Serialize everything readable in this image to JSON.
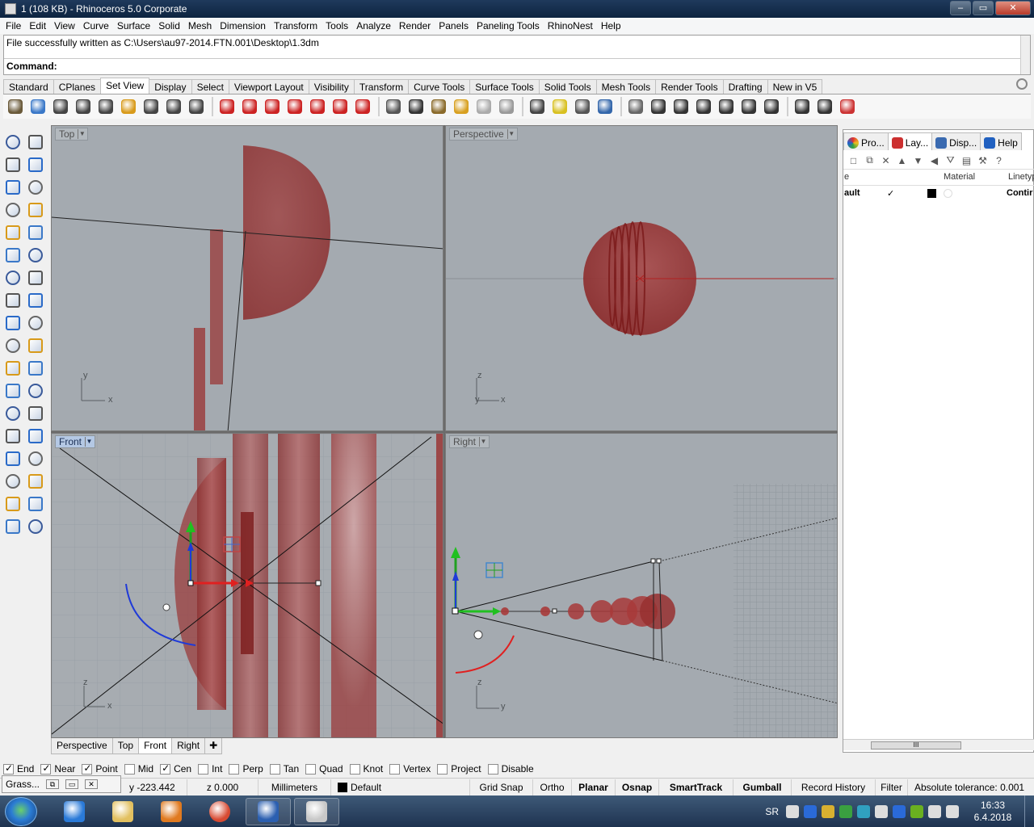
{
  "window": {
    "title": "1 (108 KB) - Rhinoceros  5.0 Corporate",
    "controls": [
      "–",
      "▭",
      "✕"
    ]
  },
  "menu": [
    "File",
    "Edit",
    "View",
    "Curve",
    "Surface",
    "Solid",
    "Mesh",
    "Dimension",
    "Transform",
    "Tools",
    "Analyze",
    "Render",
    "Panels",
    "Paneling Tools",
    "RhinoNest",
    "Help"
  ],
  "command": {
    "history": "File successfully written as C:\\Users\\au97-2014.FTN.001\\Desktop\\1.3dm",
    "prompt": "Command:"
  },
  "toolbar_tabs": [
    "Standard",
    "CPlanes",
    "Set View",
    "Display",
    "Select",
    "Viewport Layout",
    "Visibility",
    "Transform",
    "Curve Tools",
    "Surface Tools",
    "Solid Tools",
    "Mesh Tools",
    "Render Tools",
    "Drafting",
    "New in V5"
  ],
  "active_toolbar_tab": "Set View",
  "toolbar_icons": [
    {
      "name": "pan-icon",
      "color": "#6a5a3a"
    },
    {
      "name": "rotate-view-icon",
      "color": "#3a78c8"
    },
    {
      "name": "zoom-icon",
      "color": "#444444"
    },
    {
      "name": "zoom-extents-icon",
      "color": "#444444"
    },
    {
      "name": "zoom-window-icon",
      "color": "#444444"
    },
    {
      "name": "zoom-selected-icon",
      "color": "#d89a1a"
    },
    {
      "name": "undo-view-icon",
      "color": "#444444"
    },
    {
      "name": "zoom-out-icon",
      "color": "#444444"
    },
    {
      "name": "zoom-1to1-icon",
      "color": "#444444"
    },
    {
      "name": "viewport-top-icon",
      "color": "#cc2222"
    },
    {
      "name": "viewport-front-icon",
      "color": "#cc2222"
    },
    {
      "name": "car-view-1-icon",
      "color": "#cc2222"
    },
    {
      "name": "car-view-2-icon",
      "color": "#cc2222"
    },
    {
      "name": "car-view-3-icon",
      "color": "#cc2222"
    },
    {
      "name": "car-view-4-icon",
      "color": "#cc2222"
    },
    {
      "name": "car-view-5-icon",
      "color": "#cc2222"
    },
    {
      "name": "camera-target-icon",
      "color": "#555555"
    },
    {
      "name": "camera-icon",
      "color": "#333333"
    },
    {
      "name": "named-views-icon",
      "color": "#8a6a2a"
    },
    {
      "name": "named-cplanes-icon",
      "color": "#d8a020"
    },
    {
      "name": "sphere-light-icon",
      "color": "#aaaaaa"
    },
    {
      "name": "spotlight-icon",
      "color": "#999999"
    },
    {
      "name": "target-icon",
      "color": "#444444"
    },
    {
      "name": "target-yellow-icon",
      "color": "#d8c020"
    },
    {
      "name": "place-target-icon",
      "color": "#555555"
    },
    {
      "name": "snapshot-icon",
      "color": "#3366aa"
    },
    {
      "name": "box-view-icon",
      "color": "#666666"
    },
    {
      "name": "gear-mount-icon",
      "color": "#333333"
    },
    {
      "name": "gear-mount-2-icon",
      "color": "#333333"
    },
    {
      "name": "plane-icon",
      "color": "#333333"
    },
    {
      "name": "plane-2-icon",
      "color": "#333333"
    },
    {
      "name": "ship-icon",
      "color": "#333333"
    },
    {
      "name": "ship-2-icon",
      "color": "#333333"
    },
    {
      "name": "orbit-icon",
      "color": "#333333"
    },
    {
      "name": "walk-icon",
      "color": "#333333"
    },
    {
      "name": "sparkle-icon",
      "color": "#cc3333"
    }
  ],
  "left_toolbar_icons": [
    [
      "select-point-icon",
      "point-icon"
    ],
    [
      "polyline-icon",
      "curve-icon"
    ],
    [
      "circle-icon",
      "ellipse-icon"
    ],
    [
      "polygon-icon",
      "rectangle-icon"
    ],
    [
      "arc-icon",
      "fillet-curve-icon"
    ],
    [
      "surface-icon",
      "extrude-icon"
    ],
    [
      "box-icon",
      "sphere-icon"
    ],
    [
      "cylinder-icon",
      "mesh-plane-icon"
    ],
    [
      "explode-icon",
      "boolean-icon"
    ],
    [
      "split-icon",
      "trim-icon"
    ],
    [
      "boolean-union-icon",
      "group-icon"
    ],
    [
      "offset-icon",
      "blend-icon"
    ],
    [
      "text-icon",
      "dim-icon"
    ],
    [
      "array-icon",
      "align-icon"
    ],
    [
      "solid-tools-icon",
      "rib-icon"
    ],
    [
      "grid-icon",
      "properties-icon"
    ],
    [
      "layer-icon",
      "check-icon"
    ],
    [
      "analyze-icon",
      "render-icon"
    ]
  ],
  "viewports": [
    {
      "name": "Top",
      "axes": [
        "y",
        "x"
      ],
      "active": false
    },
    {
      "name": "Perspective",
      "axes": [
        "z",
        "y",
        "x"
      ],
      "active": false
    },
    {
      "name": "Front",
      "axes": [
        "z",
        "x"
      ],
      "active": true
    },
    {
      "name": "Right",
      "axes": [
        "z",
        "y"
      ],
      "active": false
    }
  ],
  "viewport_tabs": [
    "Perspective",
    "Top",
    "Front",
    "Right"
  ],
  "active_viewport_tab": "Front",
  "right_panel": {
    "tabs": [
      "Pro...",
      "Lay...",
      "Disp...",
      "Help"
    ],
    "active_tab": "Lay...",
    "columns": [
      "e",
      "Material",
      "Linetyp"
    ],
    "rows": [
      {
        "name": "ault",
        "current": "✓",
        "color": "#000000",
        "linetype": "Contir"
      }
    ],
    "scroll_thumb": "III"
  },
  "osnaps": [
    {
      "label": "End",
      "checked": true
    },
    {
      "label": "Near",
      "checked": true
    },
    {
      "label": "Point",
      "checked": true
    },
    {
      "label": "Mid",
      "checked": false
    },
    {
      "label": "Cen",
      "checked": true
    },
    {
      "label": "Int",
      "checked": false
    },
    {
      "label": "Perp",
      "checked": false
    },
    {
      "label": "Tan",
      "checked": false
    },
    {
      "label": "Quad",
      "checked": false
    },
    {
      "label": "Knot",
      "checked": false
    },
    {
      "label": "Vertex",
      "checked": false
    },
    {
      "label": "Project",
      "checked": false
    },
    {
      "label": "Disable",
      "checked": false
    }
  ],
  "grasshopper": {
    "label": "Grass..."
  },
  "status": {
    "y": "y -223.442",
    "z": "z 0.000",
    "units": "Millimeters",
    "layer": "Default",
    "layer_color": "#000000",
    "toggles": [
      {
        "label": "Grid Snap",
        "bold": false
      },
      {
        "label": "Ortho",
        "bold": false
      },
      {
        "label": "Planar",
        "bold": true
      },
      {
        "label": "Osnap",
        "bold": true
      },
      {
        "label": "SmartTrack",
        "bold": true
      },
      {
        "label": "Gumball",
        "bold": true
      },
      {
        "label": "Record History",
        "bold": false
      },
      {
        "label": "Filter",
        "bold": false
      }
    ],
    "tolerance": "Absolute tolerance: 0.001"
  },
  "taskbar": {
    "apps": [
      {
        "name": "internet-explorer-icon",
        "color": "#2a7ad8"
      },
      {
        "name": "file-explorer-icon",
        "color": "#e2c060"
      },
      {
        "name": "media-player-icon",
        "color": "#e07a20"
      },
      {
        "name": "chrome-icon",
        "color": "#d84a32"
      },
      {
        "name": "word-icon",
        "color": "#2b5fb0"
      },
      {
        "name": "rhino-icon",
        "color": "#c8c8c8"
      }
    ],
    "lang": "SR",
    "time": "16:33",
    "date": "6.4.2018",
    "tray_icons": [
      {
        "name": "keyboard-icon",
        "color": "#dddddd"
      },
      {
        "name": "help-tray-icon",
        "color": "#2a6ad8"
      },
      {
        "name": "lock-tray-icon",
        "color": "#d8b030"
      },
      {
        "name": "sync-tray-icon",
        "color": "#3aa040"
      },
      {
        "name": "alias-tray-icon",
        "color": "#30a0c0"
      },
      {
        "name": "network-tray-icon",
        "color": "#dddddd"
      },
      {
        "name": "shield-tray-icon",
        "color": "#2a6ad8"
      },
      {
        "name": "nvidia-tray-icon",
        "color": "#6ab020"
      },
      {
        "name": "wifi-tray-icon",
        "color": "#dddddd"
      },
      {
        "name": "speaker-tray-icon",
        "color": "#dddddd"
      }
    ]
  }
}
